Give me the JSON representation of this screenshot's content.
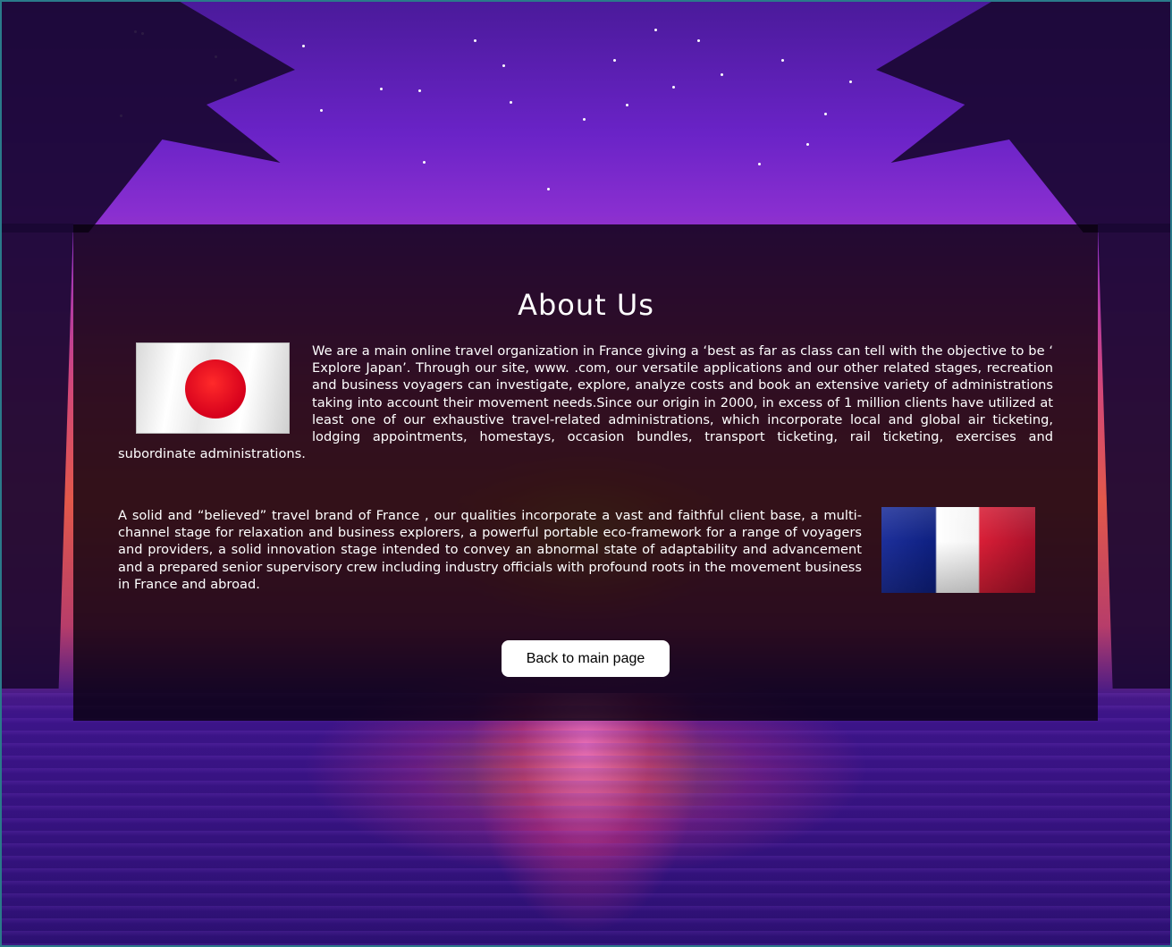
{
  "page": {
    "title": "About Us"
  },
  "content": {
    "paragraph1": "We are a main online travel organization in France giving a ‘best as far as class can tell with the objective to be ‘ Explore Japan’. Through our site, www. .com, our versatile applications and our other related stages, recreation and business voyagers can investigate, explore, analyze costs and book an extensive variety of administrations taking into account their movement needs.Since our origin in 2000, in excess of 1 million clients have utilized at least one of our exhaustive travel-related administrations, which incorporate local and global air ticketing, lodging appointments, homestays, occasion bundles, transport ticketing, rail ticketing, exercises and subordinate administrations.",
    "paragraph2": "A solid and “believed” travel brand of France , our qualities incorporate a vast and faithful client base, a multi-channel stage for relaxation and business explorers, a powerful portable eco-framework for a range of voyagers and providers, a solid innovation stage intended to convey an abnormal state of adaptability and advancement and a prepared senior supervisory crew including industry officials with profound roots in the movement business in France and abroad."
  },
  "images": {
    "flag1": "japan-flag",
    "flag2": "france-flag"
  },
  "actions": {
    "back_label": "Back to main page"
  },
  "colors": {
    "panel": "#08000c",
    "text": "#ffffff",
    "button_bg": "#ffffff"
  }
}
